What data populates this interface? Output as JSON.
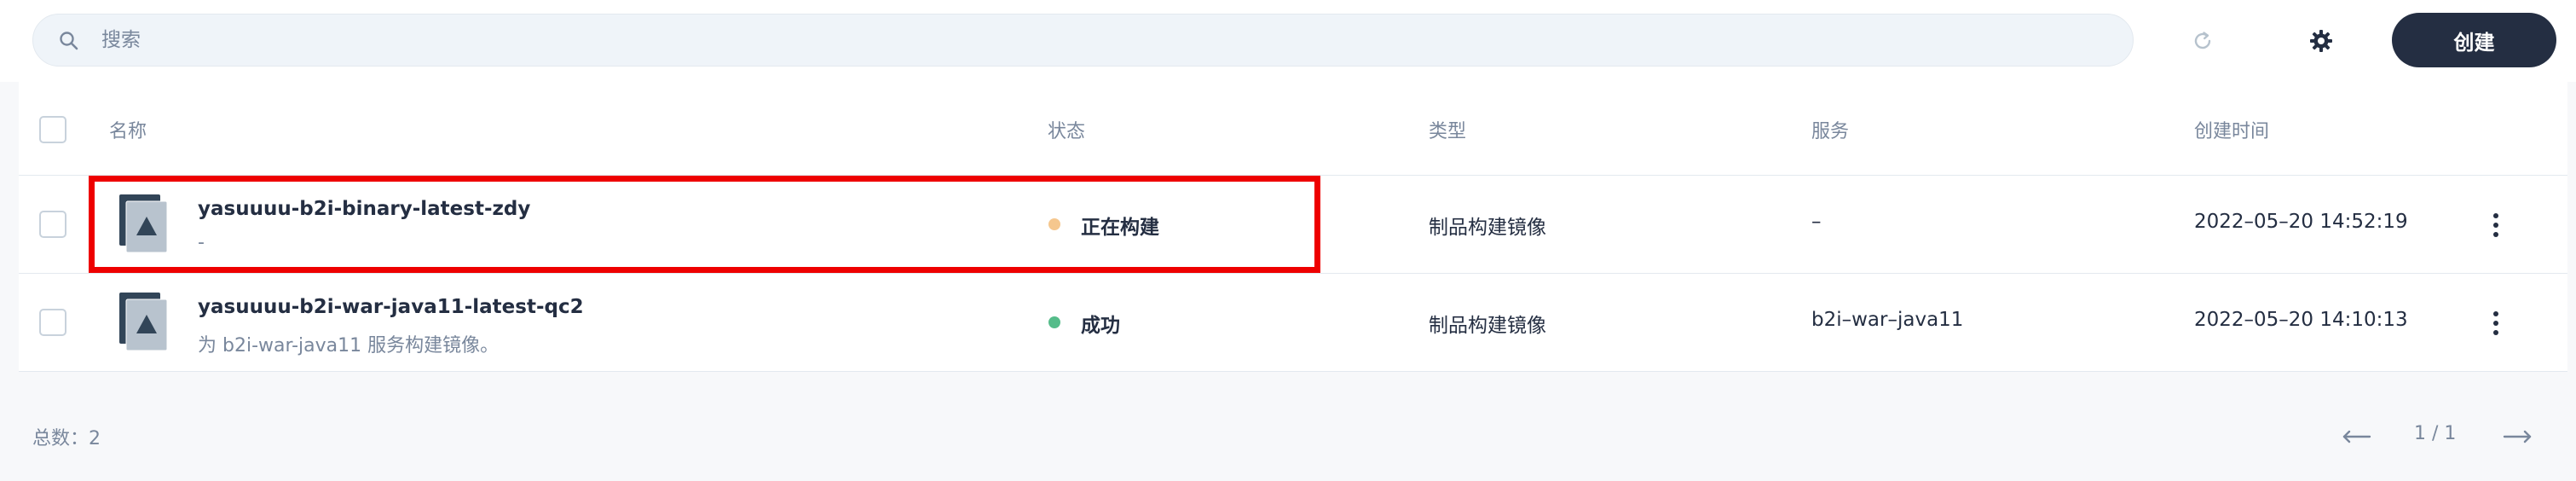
{
  "toolbar": {
    "search_placeholder": "搜索",
    "create_label": "创建",
    "icons": {
      "search": "search-icon",
      "refresh": "refresh-icon",
      "settings": "gear-icon"
    }
  },
  "table": {
    "columns": {
      "name": "名称",
      "status": "状态",
      "type": "类型",
      "service": "服务",
      "created": "创建时间"
    },
    "rows": [
      {
        "name": "yasuuuu-b2i-binary-latest-zdy",
        "description": "-",
        "status": "正在构建",
        "status_color": "#f5c78e",
        "type": "制品构建镜像",
        "service": "–",
        "created": "2022–05–20 14:52:19"
      },
      {
        "name": "yasuuuu-b2i-war-java11-latest-qc2",
        "description": "为 b2i-war-java11 服务构建镜像。",
        "status": "成功",
        "status_color": "#55bc8a",
        "type": "制品构建镜像",
        "service": "b2i–war–java11",
        "created": "2022–05–20 14:10:13"
      }
    ]
  },
  "footer": {
    "total_label": "总数：2",
    "page": "1 / 1"
  },
  "colors": {
    "accent": "#242e42",
    "highlight": "#ee0000"
  }
}
